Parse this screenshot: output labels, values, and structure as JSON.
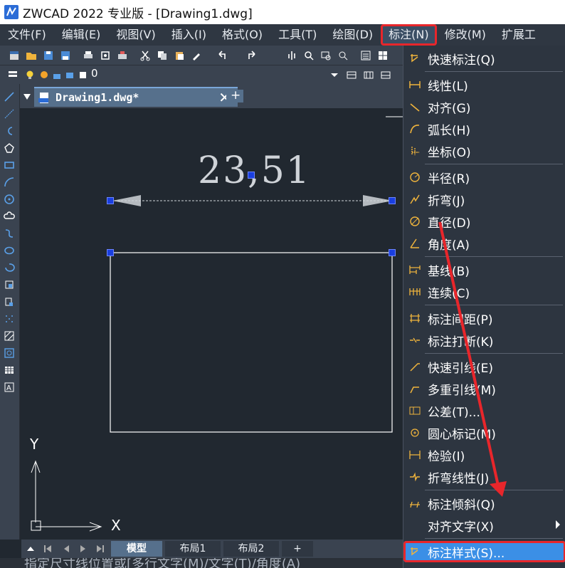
{
  "app": {
    "title": "ZWCAD 2022 专业版 - [Drawing1.dwg]"
  },
  "menubar": {
    "items": [
      {
        "label": "文件(F)"
      },
      {
        "label": "编辑(E)"
      },
      {
        "label": "视图(V)"
      },
      {
        "label": "插入(I)"
      },
      {
        "label": "格式(O)"
      },
      {
        "label": "工具(T)"
      },
      {
        "label": "绘图(D)"
      },
      {
        "label": "标注(N)",
        "active": true
      },
      {
        "label": "修改(M)"
      },
      {
        "label": "扩展工"
      }
    ]
  },
  "layer_toolbar": {
    "layer_value": "0"
  },
  "document": {
    "tab_label": "Drawing1.dwg*",
    "close": "✕",
    "new_tab": "+"
  },
  "drawing": {
    "dimension_text": "23,51"
  },
  "ucs": {
    "x_label": "X",
    "y_label": "Y"
  },
  "layout_tabs": [
    {
      "label": "模型",
      "active": true
    },
    {
      "label": "布局1"
    },
    {
      "label": "布局2"
    },
    {
      "label": "+"
    }
  ],
  "command_line": {
    "prompt": "指定尺寸线位置或[多行文字(M)/文字(T)/角度(A)"
  },
  "dimension_menu": {
    "items": [
      {
        "label": "快速标注(Q)",
        "icon": "quick-dimension-icon"
      },
      {
        "label": "线性(L)",
        "icon": "linear-dimension-icon"
      },
      {
        "label": "对齐(G)",
        "icon": "aligned-dimension-icon"
      },
      {
        "label": "弧长(H)",
        "icon": "arc-length-icon"
      },
      {
        "label": "坐标(O)",
        "icon": "ordinate-icon"
      },
      {
        "label": "半径(R)",
        "icon": "radius-icon"
      },
      {
        "label": "折弯(J)",
        "icon": "jogged-icon"
      },
      {
        "label": "直径(D)",
        "icon": "diameter-icon"
      },
      {
        "label": "角度(A)",
        "icon": "angular-icon"
      },
      {
        "label": "基线(B)",
        "icon": "baseline-icon"
      },
      {
        "label": "连续(C)",
        "icon": "continue-icon"
      },
      {
        "label": "标注间距(P)",
        "icon": "dim-space-icon"
      },
      {
        "label": "标注打断(K)",
        "icon": "dim-break-icon"
      },
      {
        "label": "快速引线(E)",
        "icon": "quick-leader-icon"
      },
      {
        "label": "多重引线(M)",
        "icon": "multileader-icon"
      },
      {
        "label": "公差(T)...",
        "icon": "tolerance-icon"
      },
      {
        "label": "圆心标记(M)",
        "icon": "center-mark-icon"
      },
      {
        "label": "检验(I)",
        "icon": "inspection-icon"
      },
      {
        "label": "折弯线性(J)",
        "icon": "jogged-linear-icon"
      },
      {
        "label": "标注倾斜(Q)",
        "icon": "oblique-icon"
      },
      {
        "label": "对齐文字(X)",
        "icon": ""
      },
      {
        "label": "标注样式(S)...",
        "icon": "dim-style-icon",
        "highlighted": true
      }
    ]
  },
  "colors": {
    "accent": "#3b8fe6",
    "highlight_border": "#e8262b",
    "grip": "#1a3fe0",
    "canvas": "#212830"
  }
}
